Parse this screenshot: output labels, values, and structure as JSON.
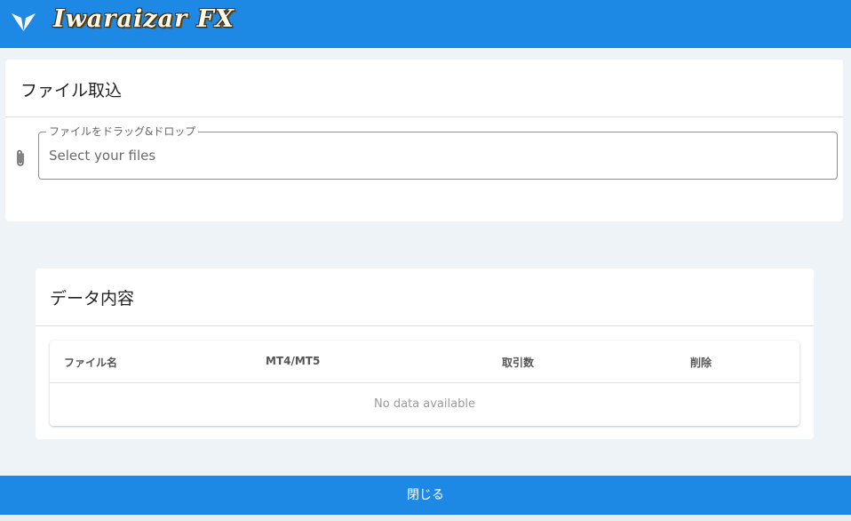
{
  "app": {
    "name": "Iwaraizar FX",
    "logo_icon": "butterfly-logo-icon",
    "header_color": "#1e88e5"
  },
  "import_card": {
    "title": "ファイル取込",
    "attach_icon": "paperclip-icon",
    "file_field": {
      "label": "ファイルをドラッグ&ドロップ",
      "placeholder": "Select your files"
    }
  },
  "data_card": {
    "title": "データ内容",
    "table": {
      "headers": [
        "ファイル名",
        "MT4/MT5",
        "取引数",
        "削除"
      ],
      "rows": [],
      "empty_text": "No data available"
    }
  },
  "footer": {
    "close_label": "閉じる",
    "button_color": "#1e88e5"
  }
}
